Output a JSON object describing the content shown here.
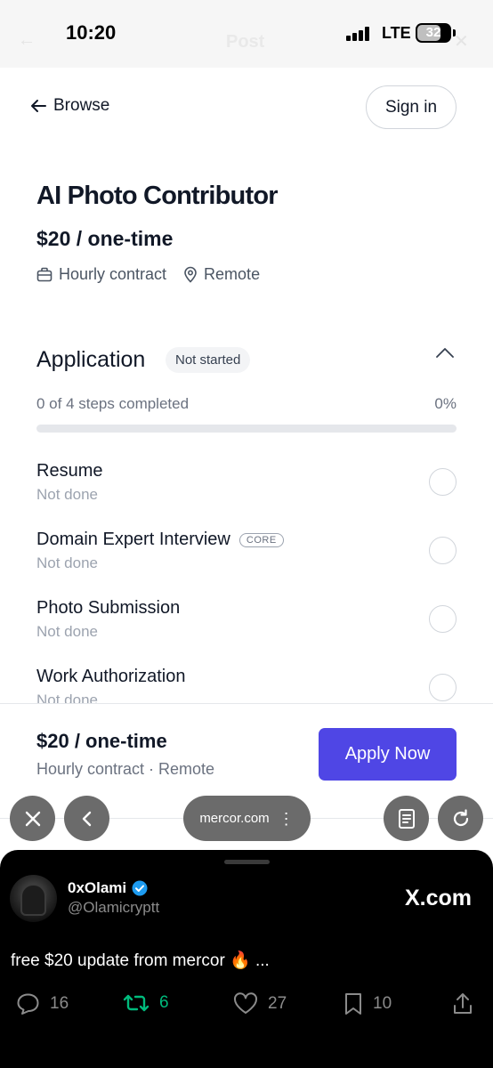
{
  "status_bar": {
    "time": "10:20",
    "network": "LTE",
    "battery": "32",
    "ghost_title": "Post"
  },
  "header": {
    "back_label": "Browse",
    "signin_label": "Sign in"
  },
  "job": {
    "title": "AI Photo Contributor",
    "price": "$20 / one-time",
    "contract_type": "Hourly contract",
    "location": "Remote"
  },
  "application": {
    "title": "Application",
    "status_badge": "Not started",
    "progress_text": "0 of 4 steps completed",
    "progress_percent_label": "0%",
    "progress_fraction": 0,
    "steps": [
      {
        "name": "Resume",
        "status": "Not done",
        "tag": ""
      },
      {
        "name": "Domain Expert Interview",
        "status": "Not done",
        "tag": "CORE"
      },
      {
        "name": "Photo Submission",
        "status": "Not done",
        "tag": ""
      },
      {
        "name": "Work Authorization",
        "status": "Not done",
        "tag": ""
      }
    ]
  },
  "bottom_bar": {
    "price": "$20 / one-time",
    "meta": "Hourly contract · Remote",
    "apply_label": "Apply Now"
  },
  "browser": {
    "url": "mercor.com"
  },
  "tweet": {
    "display_name": "0xOlami",
    "handle": "@Olamicryptt",
    "source": "X.com",
    "text": "free $20 update from mercor 🔥 ...",
    "replies": "16",
    "reposts": "6",
    "likes": "27",
    "bookmarks": "10"
  },
  "colors": {
    "accent": "#4f46e5",
    "repost_green": "#00ba7c",
    "verified_blue": "#1d9bf0"
  }
}
